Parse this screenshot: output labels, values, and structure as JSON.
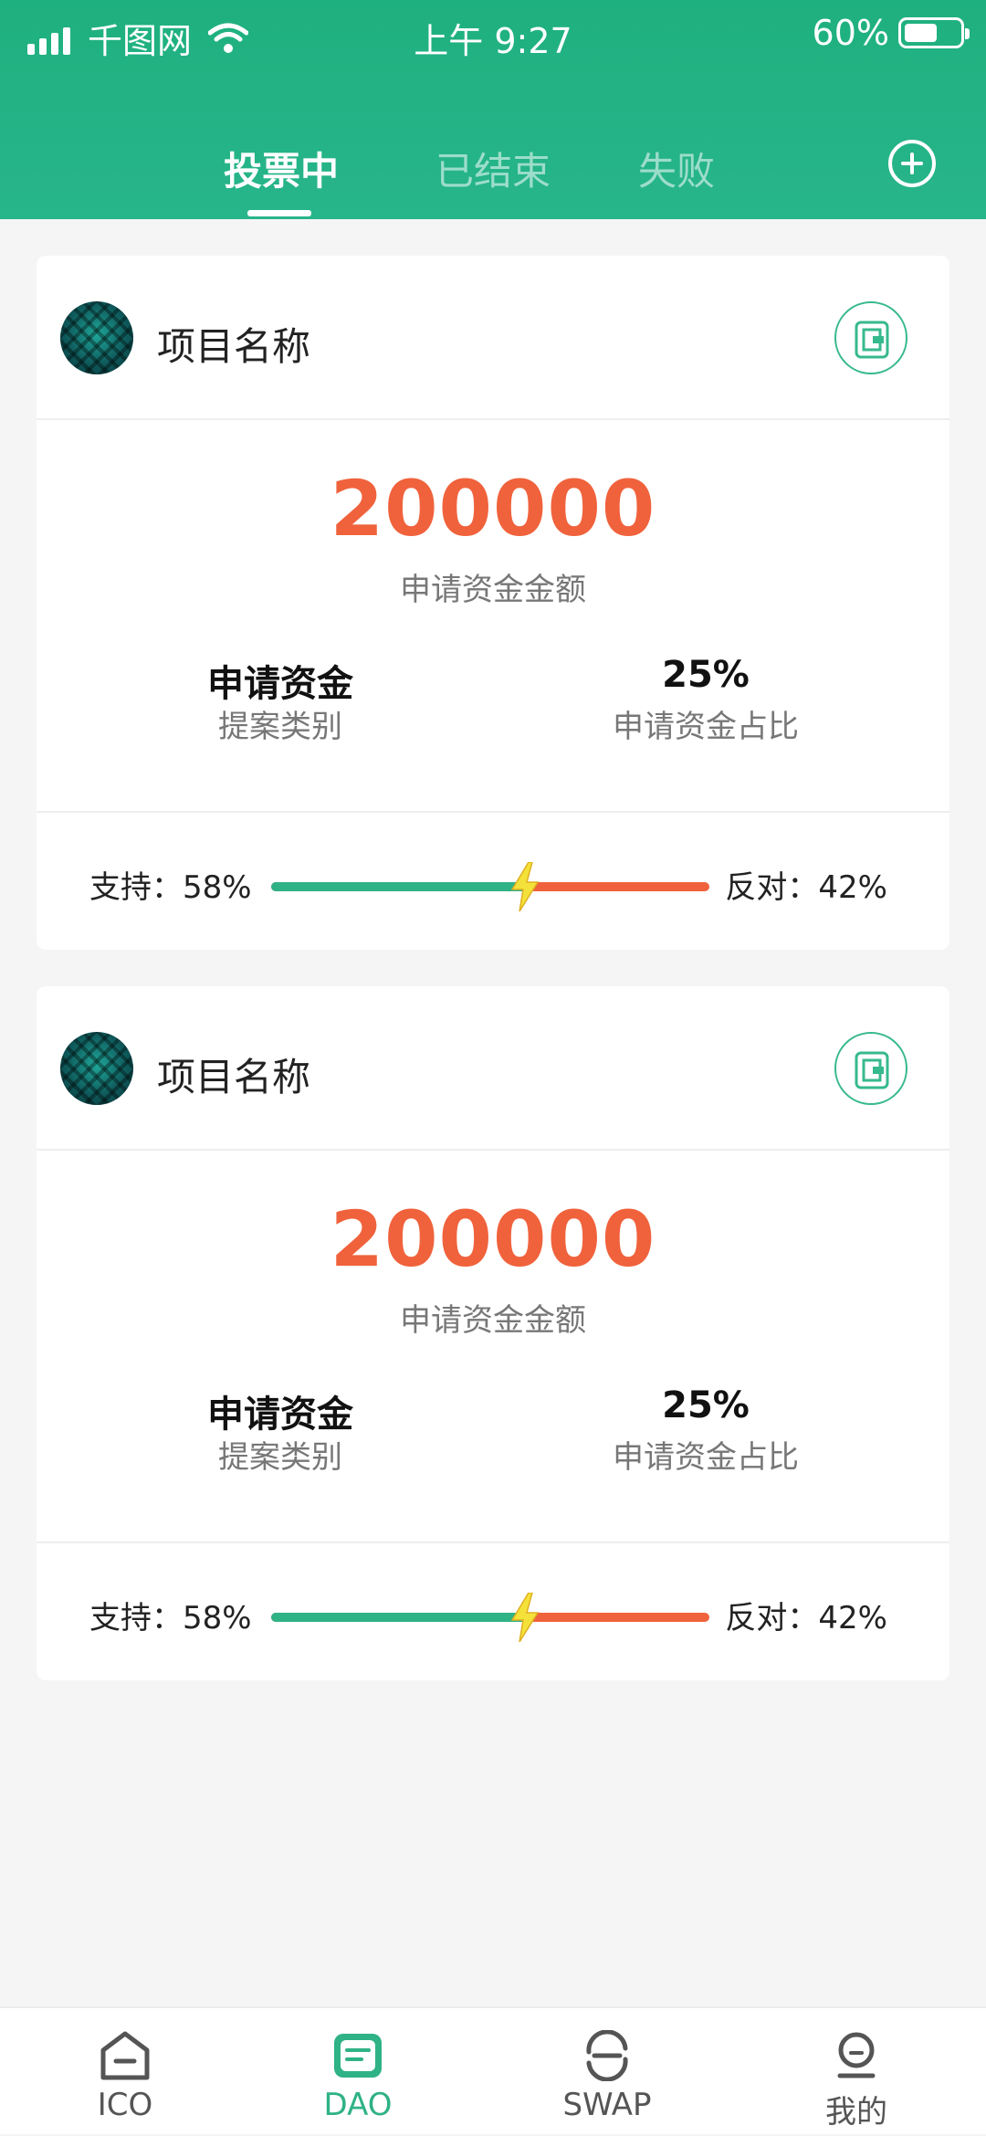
{
  "status": {
    "carrier": "千图网",
    "time": "上午 9:27",
    "battery": "60%",
    "battery_level": 0.6
  },
  "tabs": [
    {
      "label": "投票中",
      "active": true
    },
    {
      "label": "已结束",
      "active": false
    },
    {
      "label": "失败",
      "active": false
    }
  ],
  "proposals": [
    {
      "name": "项目名称",
      "amount": "200000",
      "amount_label": "申请资金金额",
      "category_value": "申请资金",
      "category_label": "提案类别",
      "ratio_value": "25%",
      "ratio_label": "申请资金占比",
      "support_label": "支持：58%",
      "oppose_label": "反对：42%",
      "support_fraction": 0.58
    },
    {
      "name": "项目名称",
      "amount": "200000",
      "amount_label": "申请资金金额",
      "category_value": "申请资金",
      "category_label": "提案类别",
      "ratio_value": "25%",
      "ratio_label": "申请资金占比",
      "support_label": "支持：58%",
      "oppose_label": "反对：42%",
      "support_fraction": 0.58
    }
  ],
  "nav": [
    {
      "label": "ICO",
      "icon": "home-icon",
      "active": false
    },
    {
      "label": "DAO",
      "icon": "dao-icon",
      "active": true
    },
    {
      "label": "SWAP",
      "icon": "swap-icon",
      "active": false
    },
    {
      "label": "我的",
      "icon": "profile-icon",
      "active": false
    }
  ],
  "colors": {
    "primary": "#1fb07f",
    "accent": "#f0623c",
    "support": "#2fb285",
    "oppose": "#f0623c"
  }
}
